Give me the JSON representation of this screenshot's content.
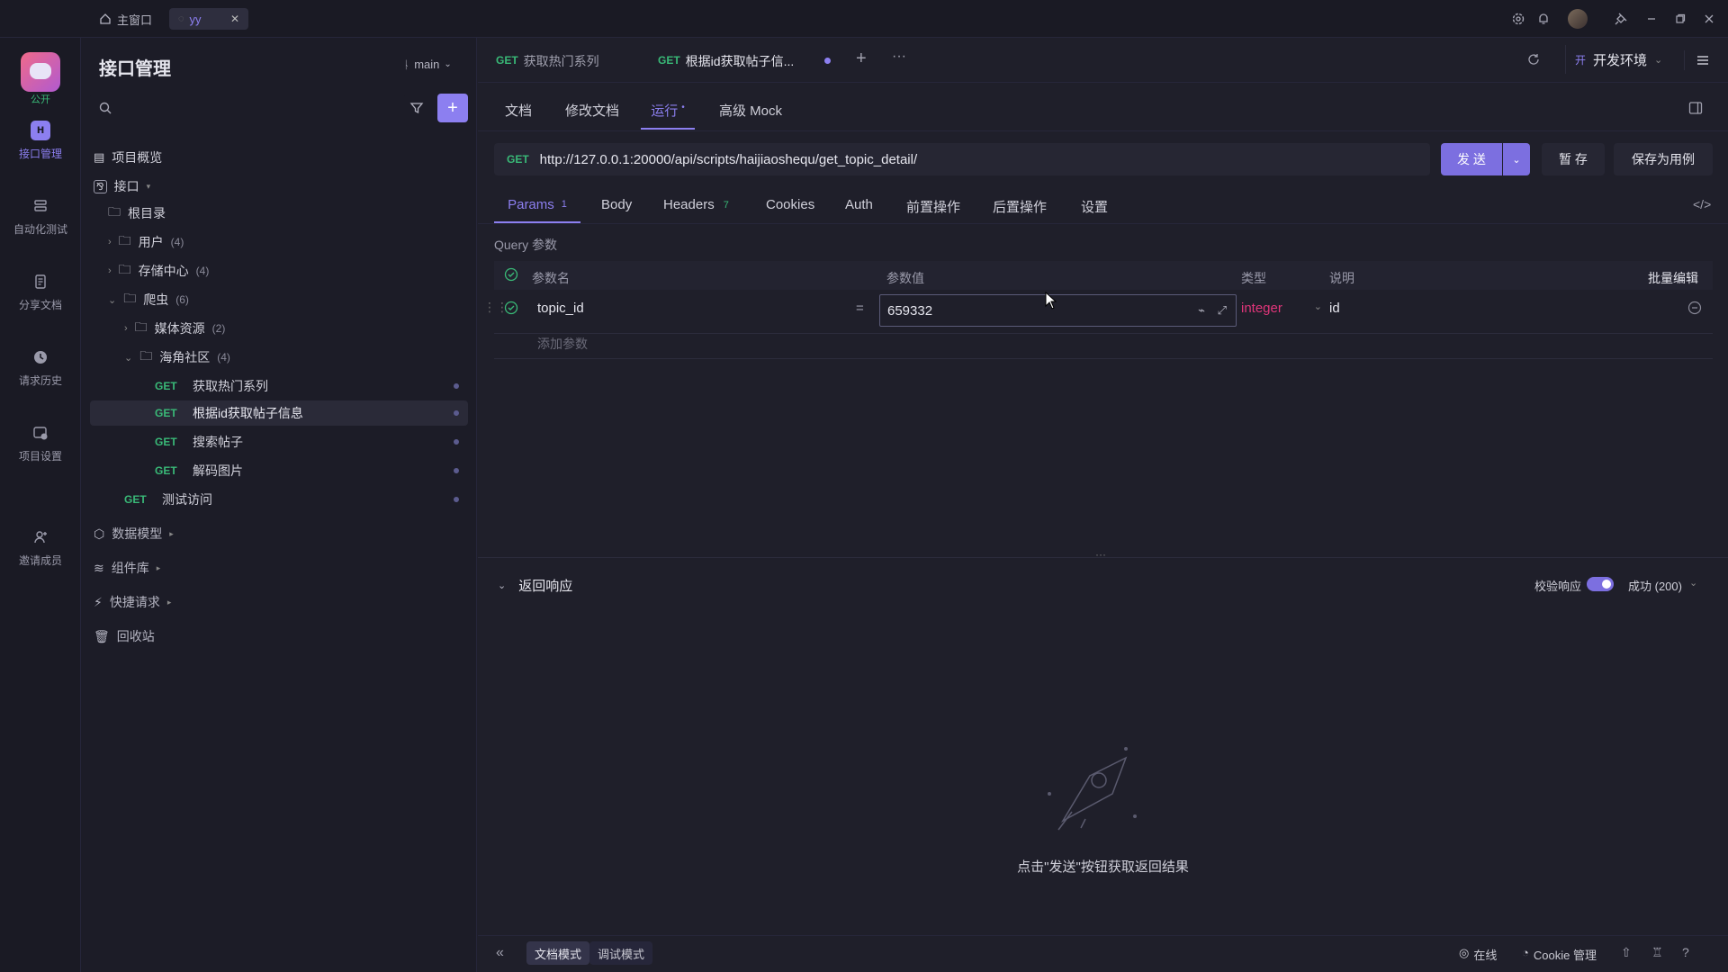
{
  "titlebar": {
    "home_tab": "主窗口",
    "project_tab": "yy"
  },
  "rail": {
    "public_label": "公开",
    "items": [
      {
        "label": "接口管理"
      },
      {
        "label": "自动化测试"
      },
      {
        "label": "分享文档"
      },
      {
        "label": "请求历史"
      },
      {
        "label": "项目设置"
      },
      {
        "label": "邀请成员"
      }
    ]
  },
  "sidebar": {
    "title": "接口管理",
    "branch": "main",
    "overview": "项目概览",
    "api_root": "接口",
    "root_dir": "根目录",
    "folders": {
      "users": {
        "label": "用户",
        "count": "(4)"
      },
      "storage": {
        "label": "存储中心",
        "count": "(4)"
      },
      "crawler": {
        "label": "爬虫",
        "count": "(6)"
      },
      "media": {
        "label": "媒体资源",
        "count": "(2)"
      },
      "haijiao": {
        "label": "海角社区",
        "count": "(4)"
      }
    },
    "endpoints": [
      {
        "method": "GET",
        "name": "获取热门系列"
      },
      {
        "method": "GET",
        "name": "根据id获取帖子信息"
      },
      {
        "method": "GET",
        "name": "搜索帖子"
      },
      {
        "method": "GET",
        "name": "解码图片"
      },
      {
        "method": "GET",
        "name": "测试访问"
      }
    ],
    "data_model": "数据模型",
    "components": "组件库",
    "quick_request": "快捷请求",
    "recycle": "回收站"
  },
  "tabs": {
    "tab1": {
      "method": "GET",
      "label": "获取热门系列"
    },
    "tab2": {
      "method": "GET",
      "label": "根据id获取帖子信..."
    }
  },
  "env": {
    "badge": "开",
    "label": "开发环境"
  },
  "subtabs": {
    "doc": "文档",
    "edit": "修改文档",
    "run": "运行",
    "mock": "高级 Mock"
  },
  "request": {
    "method": "GET",
    "url": "http://127.0.0.1:20000/api/scripts/haijiaoshequ/get_topic_detail/",
    "send": "发 送",
    "stash": "暂 存",
    "save_case": "保存为用例"
  },
  "param_tabs": {
    "params": "Params",
    "params_count": "1",
    "body": "Body",
    "headers": "Headers",
    "headers_count": "7",
    "cookies": "Cookies",
    "auth": "Auth",
    "pre": "前置操作",
    "post": "后置操作",
    "settings": "设置"
  },
  "query": {
    "section": "Query 参数",
    "col_name": "参数名",
    "col_value": "参数值",
    "col_type": "类型",
    "col_desc": "说明",
    "bulk_edit": "批量编辑",
    "row": {
      "name": "topic_id",
      "eq": "=",
      "value": "659332",
      "type": "integer",
      "desc": "id"
    },
    "add_placeholder": "添加参数"
  },
  "response": {
    "title": "返回响应",
    "validate": "校验响应",
    "status": "成功 (200)",
    "empty_hint": "点击\"发送\"按钮获取返回结果"
  },
  "footer": {
    "doc_mode": "文档模式",
    "debug_mode": "调试模式",
    "online": "在线",
    "cookie": "Cookie 管理"
  }
}
